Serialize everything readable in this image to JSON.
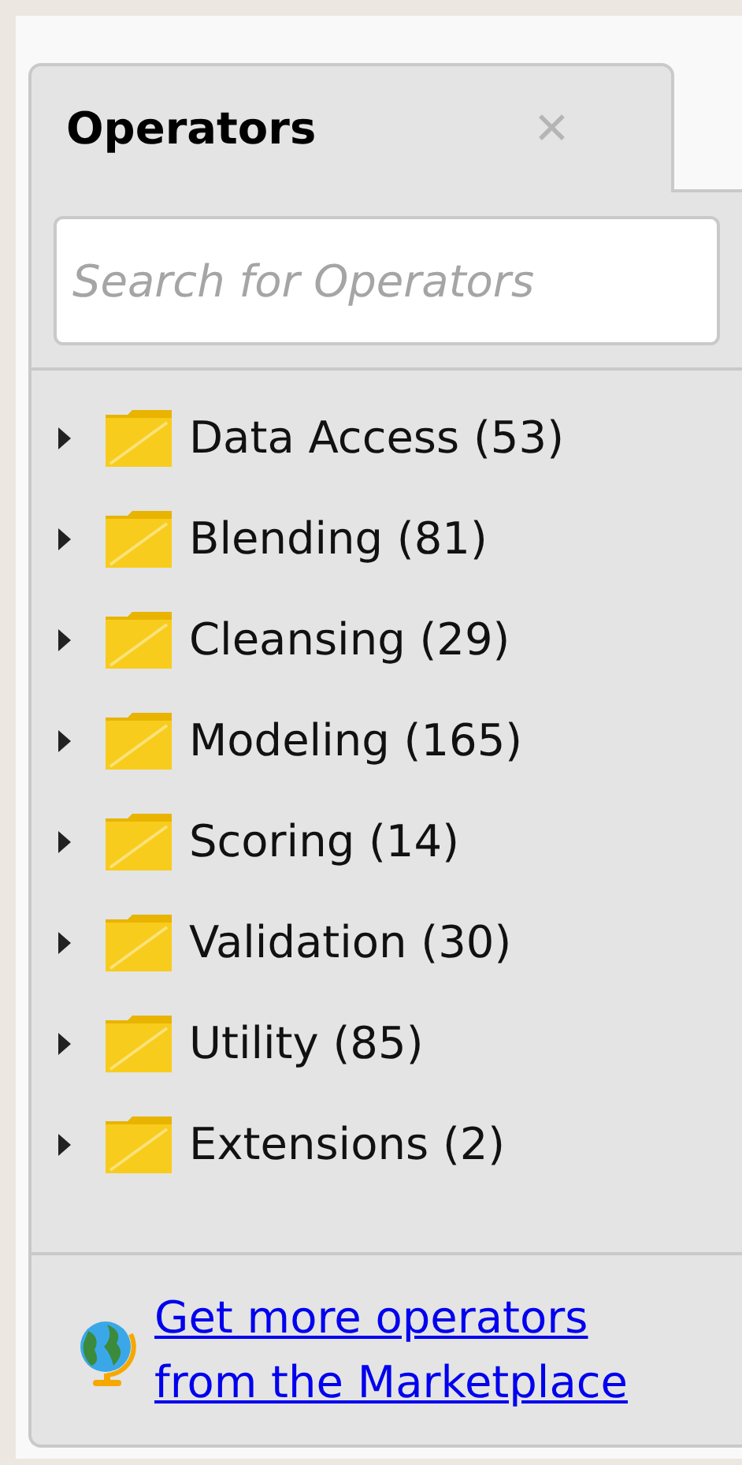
{
  "tab": {
    "title": "Operators",
    "close": "✕"
  },
  "search": {
    "placeholder": "Search for Operators"
  },
  "tree": [
    {
      "label": "Data Access (53)",
      "expanded": false
    },
    {
      "label": "Blending (81)",
      "expanded": false
    },
    {
      "label": "Cleansing (29)",
      "expanded": false
    },
    {
      "label": "Modeling (165)",
      "expanded": false
    },
    {
      "label": "Scoring (14)",
      "expanded": false
    },
    {
      "label": "Validation (30)",
      "expanded": false
    },
    {
      "label": "Utility (85)",
      "expanded": false
    },
    {
      "label": "Extensions (2)",
      "expanded": false
    }
  ],
  "footer": {
    "link": "Get more operators from the Marketplace"
  }
}
